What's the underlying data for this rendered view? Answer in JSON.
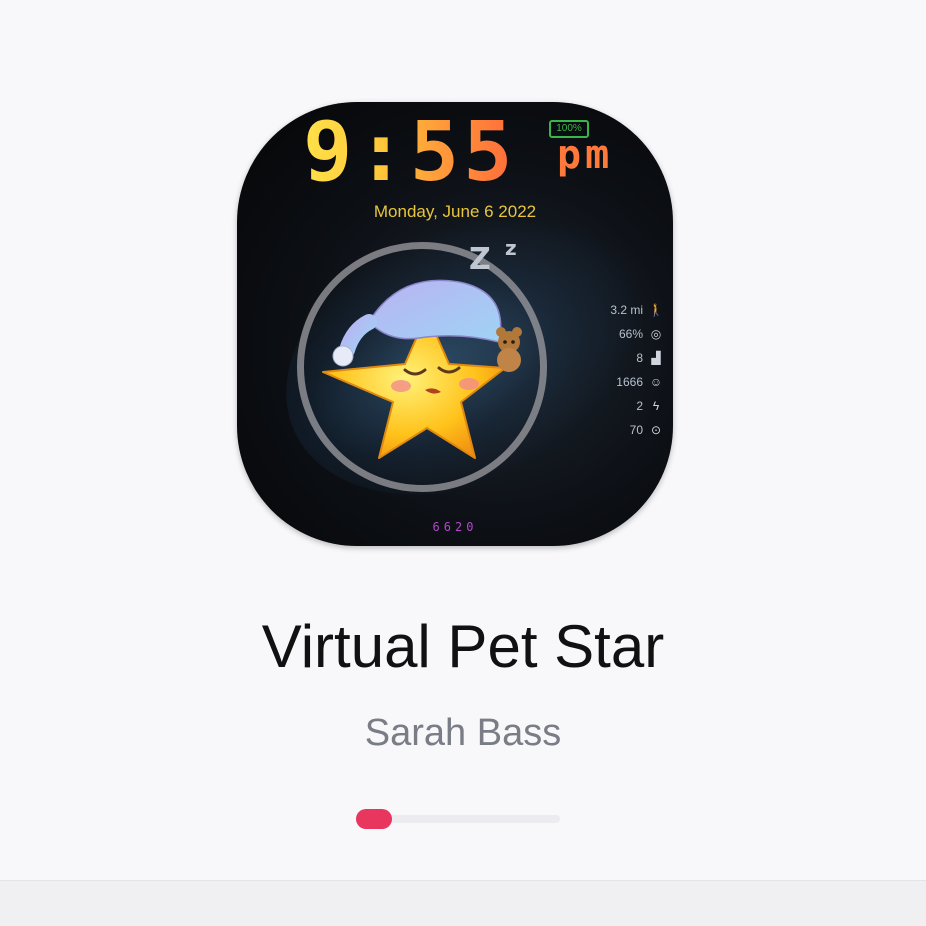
{
  "watch_face": {
    "time": "9:55",
    "ampm": "pm",
    "battery": "100%",
    "date": "Monday, June 6 2022",
    "zzz": "Z",
    "zzz_small": "z",
    "stats": [
      {
        "value": "3.2 mi",
        "icon": "walking-icon"
      },
      {
        "value": "66%",
        "icon": "target-icon"
      },
      {
        "value": "8",
        "icon": "signal-bars-icon"
      },
      {
        "value": "1666",
        "icon": "smiley-icon"
      },
      {
        "value": "2",
        "icon": "lightning-icon"
      },
      {
        "value": "70",
        "icon": "heart-circle-icon"
      }
    ],
    "code": "6620"
  },
  "title": "Virtual Pet Star",
  "author": "Sarah Bass",
  "progress": {
    "fraction": 0.17,
    "color": "#e8365e"
  },
  "colors": {
    "accent": "#e8365e",
    "time_gradient_start": "#ffe14a",
    "time_gradient_end": "#ff6a3a",
    "date": "#e8c63a",
    "code": "#b048c8"
  }
}
